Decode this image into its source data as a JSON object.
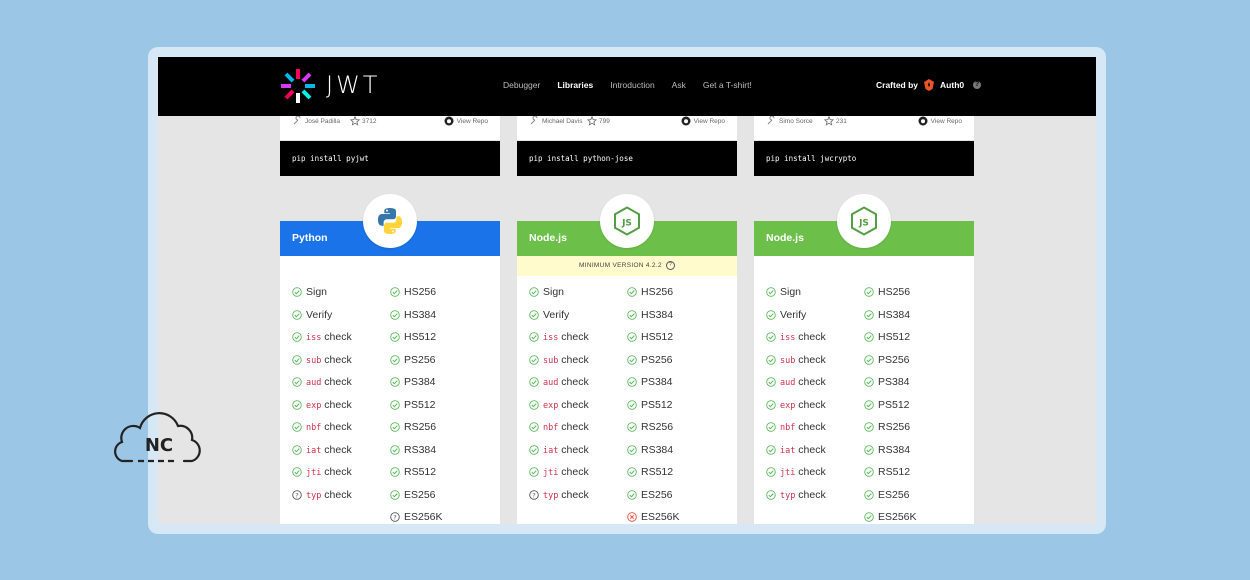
{
  "header": {
    "logo_text": "JWT",
    "nav": [
      "Debugger",
      "Libraries",
      "Introduction",
      "Ask",
      "Get a T-shirt!"
    ],
    "active_nav": "Libraries",
    "crafted_by": "Crafted by",
    "brand": "Auth0"
  },
  "prev_cards": [
    {
      "author": "José Padilla",
      "stars": "3712",
      "repo": "View Repo",
      "install": "pip install pyjwt"
    },
    {
      "author": "Michael Davis",
      "stars": "799",
      "repo": "View Repo",
      "install": "pip install python-jose"
    },
    {
      "author": "Simo Sorce",
      "stars": "231",
      "repo": "View Repo",
      "install": "pip install jwcrypto"
    }
  ],
  "cards": [
    {
      "title": "Python",
      "min_version": "",
      "features": [
        {
          "code": "",
          "label": "Sign",
          "status": "ok"
        },
        {
          "code": "",
          "label": "Verify",
          "status": "ok"
        },
        {
          "code": "iss",
          "label": " check",
          "status": "ok"
        },
        {
          "code": "sub",
          "label": " check",
          "status": "ok"
        },
        {
          "code": "aud",
          "label": " check",
          "status": "ok"
        },
        {
          "code": "exp",
          "label": " check",
          "status": "ok"
        },
        {
          "code": "nbf",
          "label": " check",
          "status": "ok"
        },
        {
          "code": "iat",
          "label": " check",
          "status": "ok"
        },
        {
          "code": "jti",
          "label": " check",
          "status": "ok"
        },
        {
          "code": "typ",
          "label": " check",
          "status": "unknown"
        }
      ],
      "algorithms": [
        {
          "label": "HS256",
          "status": "ok"
        },
        {
          "label": "HS384",
          "status": "ok"
        },
        {
          "label": "HS512",
          "status": "ok"
        },
        {
          "label": "PS256",
          "status": "ok"
        },
        {
          "label": "PS384",
          "status": "ok"
        },
        {
          "label": "PS512",
          "status": "ok"
        },
        {
          "label": "RS256",
          "status": "ok"
        },
        {
          "label": "RS384",
          "status": "ok"
        },
        {
          "label": "RS512",
          "status": "ok"
        },
        {
          "label": "ES256",
          "status": "ok"
        },
        {
          "label": "ES256K",
          "status": "unknown"
        }
      ]
    },
    {
      "title": "Node.js",
      "min_version": "MINIMUM VERSION 4.2.2",
      "features": [
        {
          "code": "",
          "label": "Sign",
          "status": "ok"
        },
        {
          "code": "",
          "label": "Verify",
          "status": "ok"
        },
        {
          "code": "iss",
          "label": " check",
          "status": "ok"
        },
        {
          "code": "sub",
          "label": " check",
          "status": "ok"
        },
        {
          "code": "aud",
          "label": " check",
          "status": "ok"
        },
        {
          "code": "exp",
          "label": " check",
          "status": "ok"
        },
        {
          "code": "nbf",
          "label": " check",
          "status": "ok"
        },
        {
          "code": "iat",
          "label": " check",
          "status": "ok"
        },
        {
          "code": "jti",
          "label": " check",
          "status": "ok"
        },
        {
          "code": "typ",
          "label": " check",
          "status": "unknown"
        }
      ],
      "algorithms": [
        {
          "label": "HS256",
          "status": "ok"
        },
        {
          "label": "HS384",
          "status": "ok"
        },
        {
          "label": "HS512",
          "status": "ok"
        },
        {
          "label": "PS256",
          "status": "ok"
        },
        {
          "label": "PS384",
          "status": "ok"
        },
        {
          "label": "PS512",
          "status": "ok"
        },
        {
          "label": "RS256",
          "status": "ok"
        },
        {
          "label": "RS384",
          "status": "ok"
        },
        {
          "label": "RS512",
          "status": "ok"
        },
        {
          "label": "ES256",
          "status": "ok"
        },
        {
          "label": "ES256K",
          "status": "no"
        }
      ]
    },
    {
      "title": "Node.js",
      "min_version": "",
      "features": [
        {
          "code": "",
          "label": "Sign",
          "status": "ok"
        },
        {
          "code": "",
          "label": "Verify",
          "status": "ok"
        },
        {
          "code": "iss",
          "label": " check",
          "status": "ok"
        },
        {
          "code": "sub",
          "label": " check",
          "status": "ok"
        },
        {
          "code": "aud",
          "label": " check",
          "status": "ok"
        },
        {
          "code": "exp",
          "label": " check",
          "status": "ok"
        },
        {
          "code": "nbf",
          "label": " check",
          "status": "ok"
        },
        {
          "code": "iat",
          "label": " check",
          "status": "ok"
        },
        {
          "code": "jti",
          "label": " check",
          "status": "ok"
        },
        {
          "code": "typ",
          "label": " check",
          "status": "ok"
        }
      ],
      "algorithms": [
        {
          "label": "HS256",
          "status": "ok"
        },
        {
          "label": "HS384",
          "status": "ok"
        },
        {
          "label": "HS512",
          "status": "ok"
        },
        {
          "label": "PS256",
          "status": "ok"
        },
        {
          "label": "PS384",
          "status": "ok"
        },
        {
          "label": "PS512",
          "status": "ok"
        },
        {
          "label": "RS256",
          "status": "ok"
        },
        {
          "label": "RS384",
          "status": "ok"
        },
        {
          "label": "RS512",
          "status": "ok"
        },
        {
          "label": "ES256",
          "status": "ok"
        },
        {
          "label": "ES256K",
          "status": "ok"
        }
      ]
    }
  ],
  "watermark": "NC",
  "colors": {
    "ok": "#5cb85c",
    "no": "#e74c3c",
    "unknown": "#555555",
    "python": "#1a73e8",
    "node": "#6cc04a",
    "claim_code": "#d0314b"
  }
}
